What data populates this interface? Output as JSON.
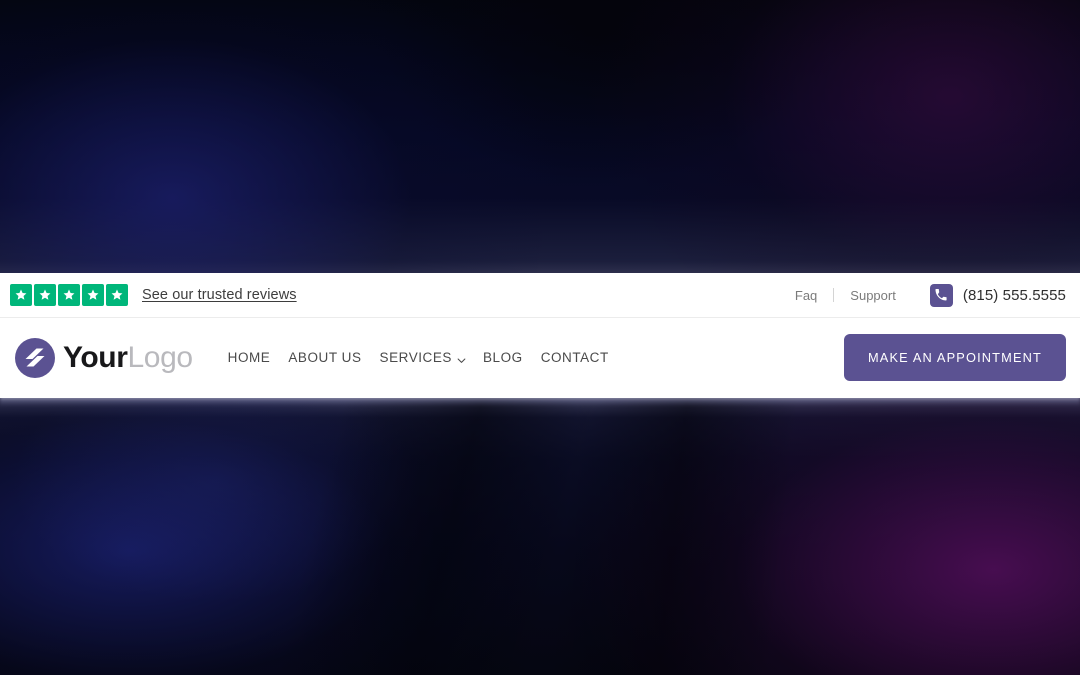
{
  "topbar": {
    "rating": {
      "star_count": 5,
      "star_color": "#00b67a",
      "star_icon": "star-icon"
    },
    "reviews_link": "See our trusted reviews",
    "links": [
      {
        "label": "Faq"
      },
      {
        "label": "Support"
      }
    ],
    "separator": "|",
    "phone": {
      "icon": "phone-icon",
      "number": "(815) 555.5555",
      "icon_color": "#5b5292"
    }
  },
  "navbar": {
    "logo": {
      "icon": "logo-swoosh-icon",
      "text_bold": "Your",
      "text_light": "Logo",
      "mark_color": "#5b5292"
    },
    "items": [
      {
        "label": "HOME",
        "has_dropdown": false
      },
      {
        "label": "ABOUT US",
        "has_dropdown": false
      },
      {
        "label": "SERVICES",
        "has_dropdown": true,
        "dropdown_icon": "chevron-down-icon"
      },
      {
        "label": "BLOG",
        "has_dropdown": false
      },
      {
        "label": "CONTACT",
        "has_dropdown": false
      }
    ],
    "cta_label": "MAKE AN APPOINTMENT",
    "cta_color": "#5b5292"
  },
  "background": {
    "top_color": "#04061a",
    "bottom_left_color": "#0c1030",
    "bottom_right_color": "#3a0a42"
  }
}
